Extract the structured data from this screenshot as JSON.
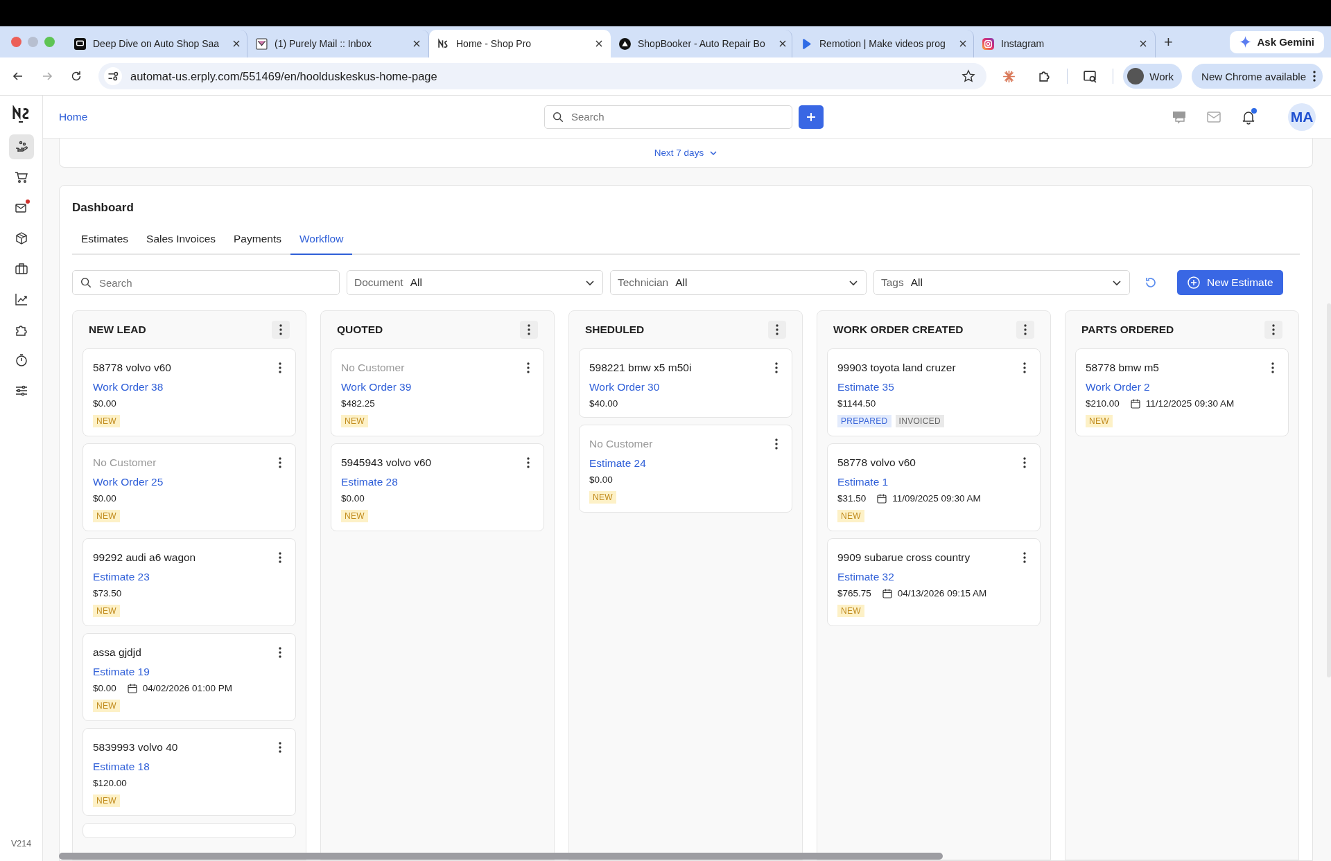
{
  "browser": {
    "tabs": [
      {
        "title": "Deep Dive on Auto Shop Saa",
        "selected": false
      },
      {
        "title": "(1) Purely Mail :: Inbox",
        "selected": false
      },
      {
        "title": "Home - Shop Pro",
        "selected": true
      },
      {
        "title": "ShopBooker - Auto Repair Bo",
        "selected": false
      },
      {
        "title": "Remotion | Make videos prog",
        "selected": false
      },
      {
        "title": "Instagram",
        "selected": false
      }
    ],
    "new_tab": "+",
    "gemini": "Ask Gemini",
    "url": "automat-us.erply.com/551469/en/hoolduskeskus-home-page",
    "profile": "Work",
    "update": "New Chrome available"
  },
  "sidebar": {
    "items": [
      {
        "kind": "hand",
        "selected": true,
        "badge": false
      },
      {
        "kind": "cart",
        "selected": false,
        "badge": false
      },
      {
        "kind": "mail",
        "selected": false,
        "badge": true
      },
      {
        "kind": "box",
        "selected": false,
        "badge": false
      },
      {
        "kind": "briefcase",
        "selected": false,
        "badge": false
      },
      {
        "kind": "chart",
        "selected": false,
        "badge": false
      },
      {
        "kind": "puzzle",
        "selected": false,
        "badge": false
      },
      {
        "kind": "timer",
        "selected": false,
        "badge": false
      },
      {
        "kind": "sliders",
        "selected": false,
        "badge": false
      }
    ],
    "version": "V214"
  },
  "header": {
    "breadcrumb": "Home",
    "search": {
      "placeholder": "Search"
    },
    "avatar": "MA",
    "notification_dot": true
  },
  "range": {
    "label": "Next 7 days"
  },
  "dashboard": {
    "title": "Dashboard",
    "tabs": [
      {
        "label": "Estimates",
        "selected": false
      },
      {
        "label": "Sales Invoices",
        "selected": false
      },
      {
        "label": "Payments",
        "selected": false
      },
      {
        "label": "Workflow",
        "selected": true
      }
    ],
    "search": {
      "placeholder": "Search"
    },
    "filters": [
      {
        "label": "Document",
        "value": "All"
      },
      {
        "label": "Technician",
        "value": "All"
      },
      {
        "label": "Tags",
        "value": "All"
      }
    ],
    "new_button": "New Estimate",
    "columns": [
      {
        "title": "NEW LEAD",
        "cards": [
          {
            "customer": "58778 volvo v60",
            "no_customer": false,
            "link": "Work Order 38",
            "amount": "$0.00",
            "tags": [
              {
                "label": "NEW",
                "kind": "new"
              }
            ]
          },
          {
            "customer": "No Customer",
            "no_customer": true,
            "link": "Work Order 25",
            "amount": "$0.00",
            "tags": [
              {
                "label": "NEW",
                "kind": "new"
              }
            ]
          },
          {
            "customer": "99292 audi a6 wagon",
            "no_customer": false,
            "link": "Estimate 23",
            "amount": "$73.50",
            "tags": [
              {
                "label": "NEW",
                "kind": "new"
              }
            ]
          },
          {
            "customer": "assa gjdjd",
            "no_customer": false,
            "link": "Estimate 19",
            "amount": "$0.00",
            "date": "04/02/2026 01:00 PM",
            "tags": [
              {
                "label": "NEW",
                "kind": "new"
              }
            ]
          },
          {
            "customer": "5839993 volvo 40",
            "no_customer": false,
            "link": "Estimate 18",
            "amount": "$120.00",
            "tags": [
              {
                "label": "NEW",
                "kind": "new"
              }
            ]
          }
        ],
        "more_below": true
      },
      {
        "title": "QUOTED",
        "cards": [
          {
            "customer": "No Customer",
            "no_customer": true,
            "link": "Work Order 39",
            "amount": "$482.25",
            "tags": [
              {
                "label": "NEW",
                "kind": "new"
              }
            ]
          },
          {
            "customer": "5945943 volvo v60",
            "no_customer": false,
            "link": "Estimate 28",
            "amount": "$0.00",
            "tags": [
              {
                "label": "NEW",
                "kind": "new"
              }
            ]
          }
        ]
      },
      {
        "title": "SHEDULED",
        "cards": [
          {
            "customer": "598221 bmw x5 m50i",
            "no_customer": false,
            "link": "Work Order 30",
            "amount": "$40.00"
          },
          {
            "customer": "No Customer",
            "no_customer": true,
            "link": "Estimate 24",
            "amount": "$0.00",
            "tags": [
              {
                "label": "NEW",
                "kind": "new"
              }
            ]
          }
        ]
      },
      {
        "title": "WORK ORDER CREATED",
        "cards": [
          {
            "customer": "99903 toyota land cruzer",
            "no_customer": false,
            "link": "Estimate 35",
            "amount": "$1144.50",
            "tags": [
              {
                "label": "PREPARED",
                "kind": "prepared"
              },
              {
                "label": "INVOICED",
                "kind": "invoiced"
              }
            ]
          },
          {
            "customer": "58778 volvo v60",
            "no_customer": false,
            "link": "Estimate 1",
            "amount": "$31.50",
            "date": "11/09/2025 09:30 AM",
            "tags": [
              {
                "label": "NEW",
                "kind": "new"
              }
            ]
          },
          {
            "customer": "9909 subarue cross country",
            "no_customer": false,
            "link": "Estimate 32",
            "amount": "$765.75",
            "date": "04/13/2026 09:15 AM",
            "tags": [
              {
                "label": "NEW",
                "kind": "new"
              }
            ]
          }
        ]
      },
      {
        "title": "PARTS ORDERED",
        "cards": [
          {
            "customer": "58778 bmw m5",
            "no_customer": false,
            "link": "Work Order 2",
            "amount": "$210.00",
            "date": "11/12/2025 09:30 AM",
            "tags": [
              {
                "label": "NEW",
                "kind": "new"
              }
            ]
          }
        ]
      }
    ]
  }
}
